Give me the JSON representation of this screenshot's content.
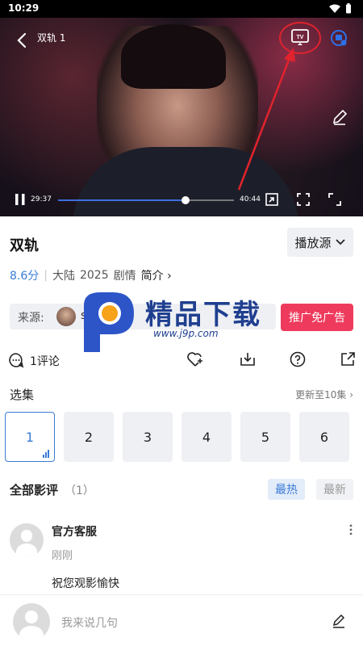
{
  "status_bar": {
    "time": "10:29"
  },
  "player": {
    "title": "双轨 1",
    "current_time": "29:37",
    "total_time": "40:44",
    "progress_fraction": 0.727
  },
  "show": {
    "title": "双轨",
    "source_button": "播放源",
    "score": "8.6分",
    "region": "大陆",
    "year": "2025",
    "genre": "剧情",
    "intro_label": "简介"
  },
  "source": {
    "label": "来源:",
    "name": "sis"
  },
  "watermark": {
    "text": "精品下载",
    "url": "www.j9p.com"
  },
  "ad_button": "推广免广告",
  "actions": {
    "comment_count": "1评论"
  },
  "episodes": {
    "header": "选集",
    "update_text": "更新至10集",
    "items": [
      "1",
      "2",
      "3",
      "4",
      "5",
      "6"
    ],
    "active": "1"
  },
  "reviews": {
    "header": "全部影评",
    "count": "（1）",
    "sort_hot": "最热",
    "sort_new": "最新",
    "items": [
      {
        "author": "官方客服",
        "time": "刚刚",
        "text": "祝您观影愉快"
      }
    ]
  },
  "bottom_bar": {
    "placeholder": "我来说几句"
  },
  "colors": {
    "accent": "#3a7bd5",
    "ad_red": "#ee3b5d",
    "annotation_red": "#e0232d"
  }
}
